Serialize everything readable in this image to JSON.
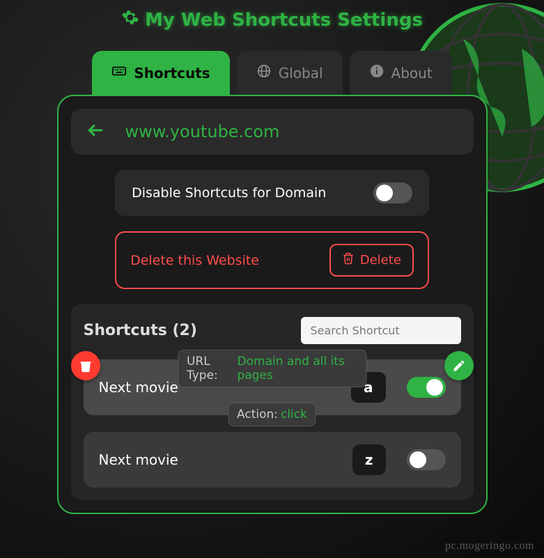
{
  "title": "My Web Shortcuts Settings",
  "tabs": {
    "shortcuts": "Shortcuts",
    "global": "Global",
    "about": "About"
  },
  "domain": "www.youtube.com",
  "disable_label": "Disable Shortcuts for Domain",
  "disable_on": false,
  "delete_section": {
    "label": "Delete this Website",
    "button": "Delete"
  },
  "shortcuts": {
    "title": "Shortcuts (2)",
    "search_placeholder": "Search Shortcut",
    "url_type_label": "URL Type:",
    "url_type_value": "Domain and all its pages",
    "action_label": "Action:",
    "action_value": "click",
    "items": [
      {
        "name": "Next movie",
        "key": "a",
        "enabled": true
      },
      {
        "name": "Next movie",
        "key": "z",
        "enabled": false
      }
    ]
  },
  "watermark": "pc.mogeringo.com"
}
